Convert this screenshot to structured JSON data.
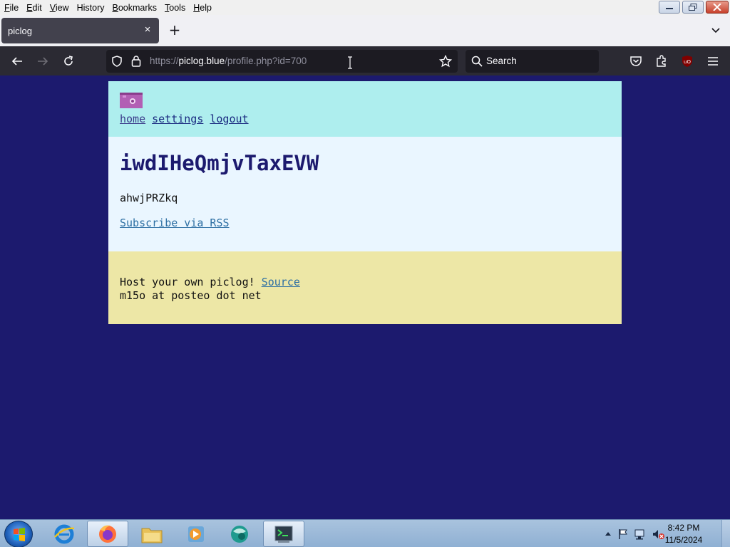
{
  "menubar": {
    "items": [
      {
        "label": "File",
        "accel": "F",
        "rest": "ile"
      },
      {
        "label": "Edit",
        "accel": "E",
        "rest": "dit"
      },
      {
        "label": "View",
        "accel": "V",
        "rest": "iew"
      },
      {
        "label": "History",
        "accel": "H",
        "rest": "istory"
      },
      {
        "label": "Bookmarks",
        "accel": "B",
        "rest": "ookmarks"
      },
      {
        "label": "Tools",
        "accel": "T",
        "rest": "ools"
      },
      {
        "label": "Help",
        "accel": "H",
        "rest": "elp"
      }
    ]
  },
  "tab": {
    "title": "piclog",
    "close": "×"
  },
  "newtab": "+",
  "urlbar": {
    "prefix": "https://",
    "host": "piclog.blue",
    "path": "/profile.php?id=700"
  },
  "searchbar": {
    "placeholder": "Search"
  },
  "page": {
    "nav": {
      "home": "home",
      "settings": "settings",
      "logout": "logout"
    },
    "title": "iwdIHeQmjvTaxEVW",
    "description": "ahwjPRZkq",
    "rss": "Subscribe via RSS",
    "footer_text": "Host your own piclog!",
    "footer_link": "Source",
    "footer_contact": "m15o at posteo dot net"
  },
  "taskbar": {
    "time": "8:42 PM",
    "date": "11/5/2024"
  },
  "colors": {
    "page_bg": "#1c1a6e",
    "header_bg": "#aeeeee",
    "content_bg": "#eaf6ff",
    "footer_bg": "#ede7a6",
    "logo": "#b25fb4"
  }
}
